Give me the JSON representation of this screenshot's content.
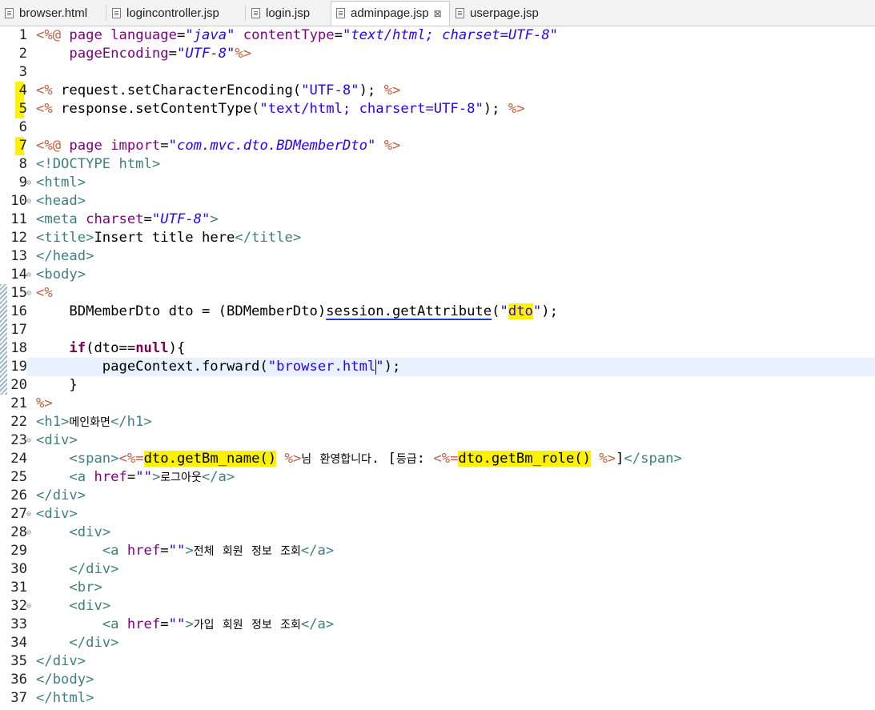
{
  "tabs": [
    {
      "label": "browser.html",
      "active": false
    },
    {
      "label": "logincontroller.jsp",
      "active": false
    },
    {
      "label": "login.jsp",
      "active": false
    },
    {
      "label": "adminpage.jsp",
      "active": true
    },
    {
      "label": "userpage.jsp",
      "active": false
    }
  ],
  "close_glyph": "⊠",
  "editor": {
    "file": "adminpage.jsp",
    "current_line": 19,
    "lines": [
      {
        "n": "1",
        "text": "<%@ page language=\"java\" contentType=\"text/html; charset=UTF-8\""
      },
      {
        "n": "2",
        "text": "    pageEncoding=\"UTF-8\"%>"
      },
      {
        "n": "3",
        "text": ""
      },
      {
        "n": "4",
        "text": "<% request.setCharacterEncoding(\"UTF-8\"); %>"
      },
      {
        "n": "5",
        "text": "<% response.setContentType(\"text/html; charsert=UTF-8\"); %>"
      },
      {
        "n": "6",
        "text": ""
      },
      {
        "n": "7",
        "text": "<%@ page import=\"com.mvc.dto.BDMemberDto\" %>"
      },
      {
        "n": "8",
        "text": "<!DOCTYPE html>"
      },
      {
        "n": "9",
        "text": "<html>"
      },
      {
        "n": "10",
        "text": "<head>"
      },
      {
        "n": "11",
        "text": "<meta charset=\"UTF-8\">"
      },
      {
        "n": "12",
        "text": "<title>Insert title here</title>"
      },
      {
        "n": "13",
        "text": "</head>"
      },
      {
        "n": "14",
        "text": "<body>"
      },
      {
        "n": "15",
        "text": "<%"
      },
      {
        "n": "16",
        "text": "    BDMemberDto dto = (BDMemberDto)session.getAttribute(\"dto\");"
      },
      {
        "n": "17",
        "text": ""
      },
      {
        "n": "18",
        "text": "    if(dto==null){"
      },
      {
        "n": "19",
        "text": "        pageContext.forward(\"browser.html\");"
      },
      {
        "n": "20",
        "text": "    }"
      },
      {
        "n": "21",
        "text": "%>"
      },
      {
        "n": "22",
        "text": "<h1>메인화면</h1>"
      },
      {
        "n": "23",
        "text": "<div>"
      },
      {
        "n": "24",
        "text": "    <span><%=dto.getBm_name() %>님 환영합니다. [등급: <%=dto.getBm_role() %>]</span>"
      },
      {
        "n": "25",
        "text": "    <a href=\"\">로그아웃</a>"
      },
      {
        "n": "26",
        "text": "</div>"
      },
      {
        "n": "27",
        "text": "<div>"
      },
      {
        "n": "28",
        "text": "    <div>"
      },
      {
        "n": "29",
        "text": "        <a href=\"\">전체 회원 정보 조회</a>"
      },
      {
        "n": "30",
        "text": "    </div>"
      },
      {
        "n": "31",
        "text": "    <br>"
      },
      {
        "n": "32",
        "text": "    <div>"
      },
      {
        "n": "33",
        "text": "        <a href=\"\">가입 회원 정보 조회</a>"
      },
      {
        "n": "34",
        "text": "    </div>"
      },
      {
        "n": "35",
        "text": "</div>"
      },
      {
        "n": "36",
        "text": "</body>"
      },
      {
        "n": "37",
        "text": "</html>"
      }
    ]
  },
  "colors": {
    "keyword": "#7f0055",
    "directive": "#bf5f3f",
    "tag": "#3f7f7f",
    "attribute": "#7f007f",
    "value": "#2a00ff",
    "highlight": "#fff200",
    "current_line": "#e8f2fe"
  }
}
